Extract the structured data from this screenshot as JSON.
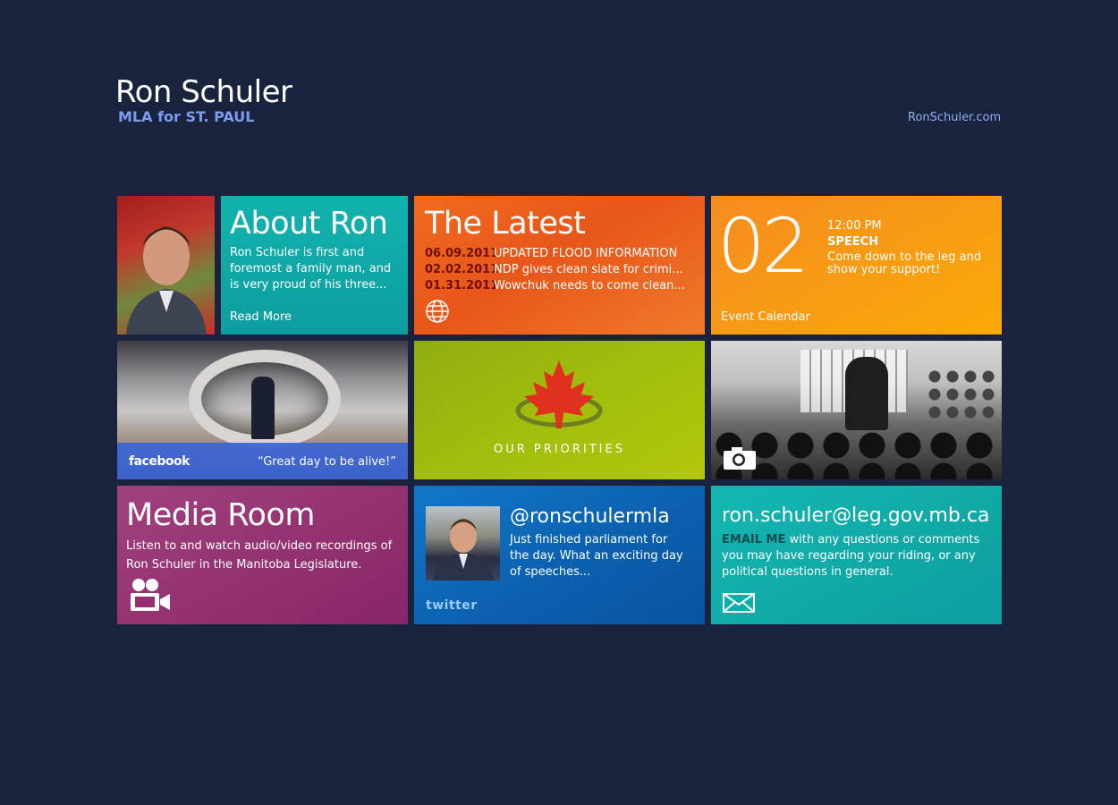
{
  "header": {
    "name": "Ron Schuler",
    "subtitle": "MLA for ST. PAUL",
    "site_link": "RonSchuler.com"
  },
  "about": {
    "title": "About Ron",
    "text": "Ron Schuler is first and foremost a family man, and is very proud of his three...",
    "read_more": "Read More"
  },
  "latest": {
    "title": "The Latest",
    "items": [
      {
        "date": "06.09.2011",
        "text": "UPDATED FLOOD INFORMATION"
      },
      {
        "date": "02.02.2011",
        "text": "NDP gives clean slate for crimi..."
      },
      {
        "date": "01.31.2011",
        "text": "Wowchuk needs to come clean..."
      }
    ],
    "icon": "globe-icon"
  },
  "calendar": {
    "day": "02",
    "time": "12:00 PM",
    "event_type": "SPEECH",
    "description": "Come down to the leg and show your support!",
    "link": "Event Calendar"
  },
  "facebook": {
    "logo": "facebook",
    "quote": "“Great day to be alive!”"
  },
  "priorities": {
    "label": "OUR PRIORITIES",
    "icon": "maple-leaf-icon"
  },
  "photo": {
    "icon": "camera-icon"
  },
  "media": {
    "title": "Media Room",
    "text": "Listen to and watch audio/video recordings of Ron Schuler in the Manitoba Legislature.",
    "icon": "video-camera-icon"
  },
  "twitter": {
    "handle": "@ronschulermla",
    "tweet": "Just finished parliament for the day. What an exciting day of speeches...",
    "logo": "twitter"
  },
  "email": {
    "address": "ron.schuler@leg.gov.mb.ca",
    "emphasis": "EMAIL ME",
    "text": " with any questions or comments you may have regarding your riding, or any political questions in general.",
    "icon": "envelope-icon"
  },
  "colors": {
    "background": "#19233d",
    "teal": "#0ea5a5",
    "orange": "#ef621e",
    "amber": "#f89a14",
    "green": "#a3bd0d",
    "magenta": "#952f70",
    "blue": "#0b62b0"
  }
}
